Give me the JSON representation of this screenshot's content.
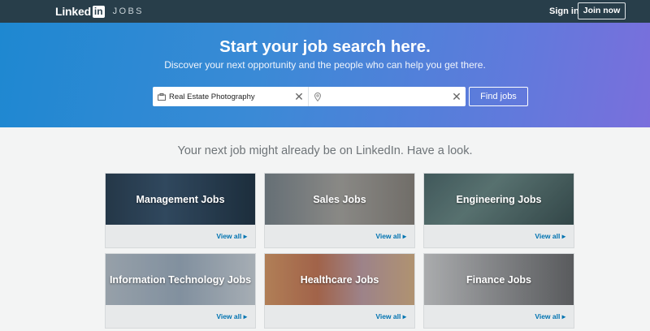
{
  "header": {
    "logo_text": "Linked",
    "logo_in": "in",
    "section": "JOBS",
    "signin_label": "Sign in",
    "join_label": "Join now"
  },
  "hero": {
    "title": "Start your job search here.",
    "subtitle": "Discover your next opportunity and the people who can help you get there.",
    "keyword_value": "Real Estate Photography",
    "location_value": "",
    "find_label": "Find jobs"
  },
  "tagline": "Your next job might already be on LinkedIn. Have a look.",
  "categories": [
    {
      "title": "Management Jobs",
      "link": "View all ▸"
    },
    {
      "title": "Sales Jobs",
      "link": "View all ▸"
    },
    {
      "title": "Engineering Jobs",
      "link": "View all ▸"
    },
    {
      "title": "Information Technology Jobs",
      "link": "View all ▸"
    },
    {
      "title": "Healthcare Jobs",
      "link": "View all ▸"
    },
    {
      "title": "Finance Jobs",
      "link": "View all ▸"
    }
  ],
  "colors": {
    "topbar": "#283e4a",
    "hero_start": "#1e88d1",
    "hero_end": "#7a6fdc",
    "link": "#0073b1"
  }
}
